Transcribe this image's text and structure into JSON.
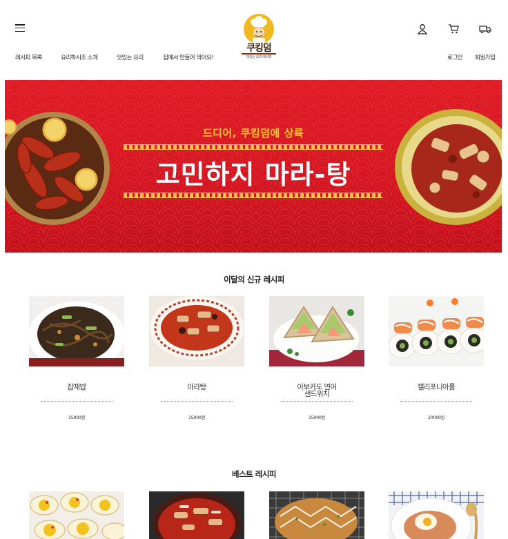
{
  "header": {
    "logo_name": "쿠킹덤",
    "logo_tagline": "맛있는 요리 레시피",
    "nav": [
      "레시피 목록",
      "요리하시조 소개",
      "맛있는 요리",
      "집에서 만들어 먹어요!"
    ],
    "login": "로그인",
    "signup": "회원가입",
    "icons": [
      "menu-icon",
      "user-icon",
      "cart-icon",
      "delivery-icon"
    ]
  },
  "banner": {
    "subtitle": "드디어, 쿠킹덤에 상륙",
    "title": "고민하지 마라-탕",
    "colors": {
      "background": "#d31722",
      "subtitle": "#ffc92b",
      "title": "#ffffff"
    }
  },
  "new_recipes": {
    "title": "이달의 신규 레시피",
    "items": [
      {
        "name": "잡채밥",
        "price": "15000원"
      },
      {
        "name": "마라탕",
        "price": "15000원"
      },
      {
        "name": "아보카도 연어\n샌드위치",
        "price": "15000원"
      },
      {
        "name": "캘리포니아롤",
        "price": "20000원"
      }
    ]
  },
  "best_recipes": {
    "title": "베스트 레시피"
  }
}
